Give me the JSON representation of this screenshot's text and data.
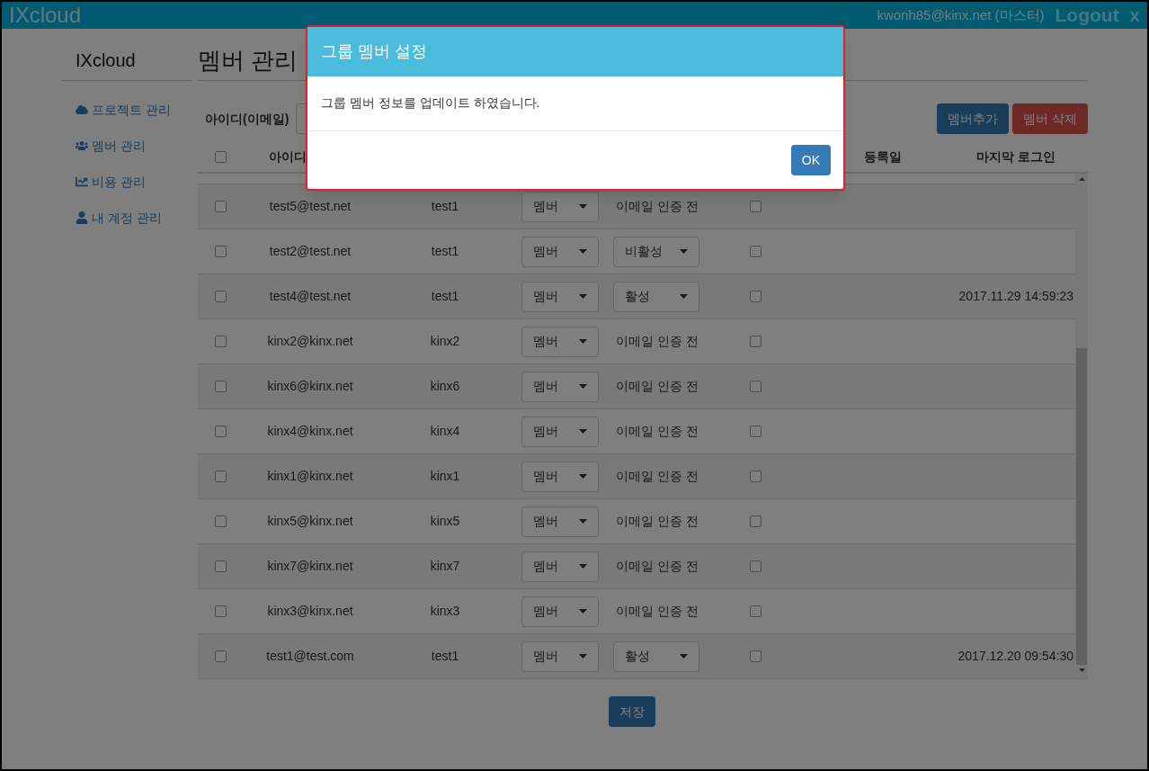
{
  "topbar": {
    "brand": "IXcloud",
    "user": "kwonh85@kinx.net (마스터)",
    "logout": "Logout  x"
  },
  "sidebar": {
    "title": "IXcloud",
    "items": [
      {
        "label": "프로젝트 관리"
      },
      {
        "label": "멤버 관리"
      },
      {
        "label": "비용 관리"
      },
      {
        "label": "내 계정 관리"
      }
    ]
  },
  "page_title": "멤버 관리",
  "filter": {
    "label": "아이디(이메일)"
  },
  "actions": {
    "add": "멤버추가",
    "delete": "멤버 삭제"
  },
  "table": {
    "select_all": {
      "checked": false
    },
    "columns": {
      "id": "아이디",
      "registered": "등록일",
      "last_login": "마지막 로그인"
    },
    "rows": [
      {
        "checked": false,
        "email": "test5@test.net",
        "name": "test1",
        "role": "멤버",
        "status": {
          "kind": "text",
          "label": "이메일 인증 전"
        },
        "flag": false
      },
      {
        "checked": false,
        "email": "test2@test.net",
        "name": "test1",
        "role": "멤버",
        "status": {
          "kind": "select",
          "label": "비활성"
        },
        "flag": false
      },
      {
        "checked": false,
        "email": "test4@test.net",
        "name": "test1",
        "role": "멤버",
        "status": {
          "kind": "select",
          "label": "활성"
        },
        "flag": false,
        "last_login": "2017.11.29 14:59:23"
      },
      {
        "checked": false,
        "email": "kinx2@kinx.net",
        "name": "kinx2",
        "role": "멤버",
        "status": {
          "kind": "text",
          "label": "이메일 인증 전"
        },
        "flag": false
      },
      {
        "checked": false,
        "email": "kinx6@kinx.net",
        "name": "kinx6",
        "role": "멤버",
        "status": {
          "kind": "text",
          "label": "이메일 인증 전"
        },
        "flag": false
      },
      {
        "checked": false,
        "email": "kinx4@kinx.net",
        "name": "kinx4",
        "role": "멤버",
        "status": {
          "kind": "text",
          "label": "이메일 인증 전"
        },
        "flag": false
      },
      {
        "checked": false,
        "email": "kinx1@kinx.net",
        "name": "kinx1",
        "role": "멤버",
        "status": {
          "kind": "text",
          "label": "이메일 인증 전"
        },
        "flag": false
      },
      {
        "checked": false,
        "email": "kinx5@kinx.net",
        "name": "kinx5",
        "role": "멤버",
        "status": {
          "kind": "text",
          "label": "이메일 인증 전"
        },
        "flag": false
      },
      {
        "checked": false,
        "email": "kinx7@kinx.net",
        "name": "kinx7",
        "role": "멤버",
        "status": {
          "kind": "text",
          "label": "이메일 인증 전"
        },
        "flag": false
      },
      {
        "checked": false,
        "email": "kinx3@kinx.net",
        "name": "kinx3",
        "role": "멤버",
        "status": {
          "kind": "text",
          "label": "이메일 인증 전"
        },
        "flag": false
      },
      {
        "checked": false,
        "email": "test1@test.com",
        "name": "test1",
        "role": "멤버",
        "status": {
          "kind": "select",
          "label": "활성"
        },
        "flag": false,
        "last_login": "2017.12.20 09:54:30"
      }
    ]
  },
  "save": "저장",
  "dialog": {
    "title": "그룹 멤버 설정",
    "message": "그룹 멤버 정보를 업데이트 하였습니다.",
    "ok": "OK"
  }
}
